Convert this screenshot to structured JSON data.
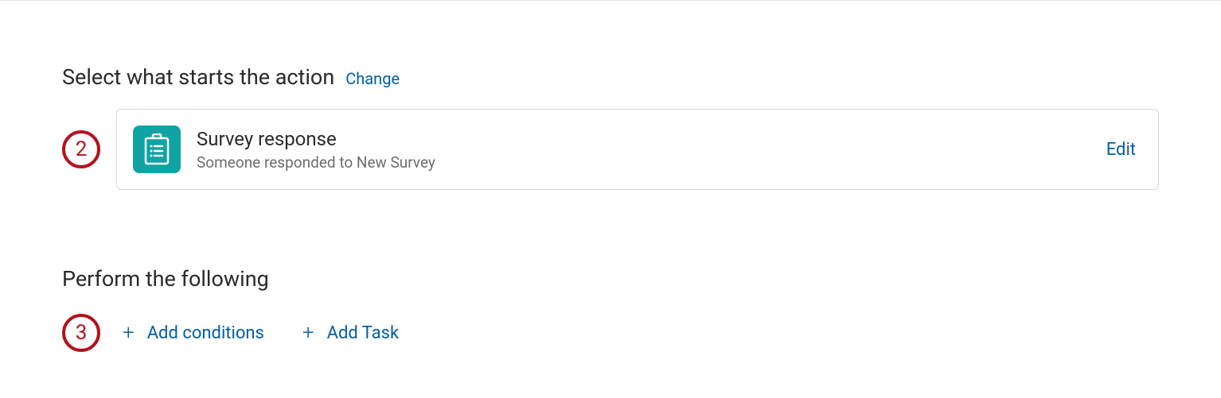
{
  "section1": {
    "title": "Select what starts the action",
    "change_label": "Change",
    "step_number": "2",
    "trigger": {
      "title": "Survey response",
      "subtitle": "Someone responded to New Survey",
      "edit_label": "Edit"
    }
  },
  "section2": {
    "title": "Perform the following",
    "step_number": "3",
    "add_conditions_label": "Add conditions",
    "add_task_label": "Add Task"
  }
}
